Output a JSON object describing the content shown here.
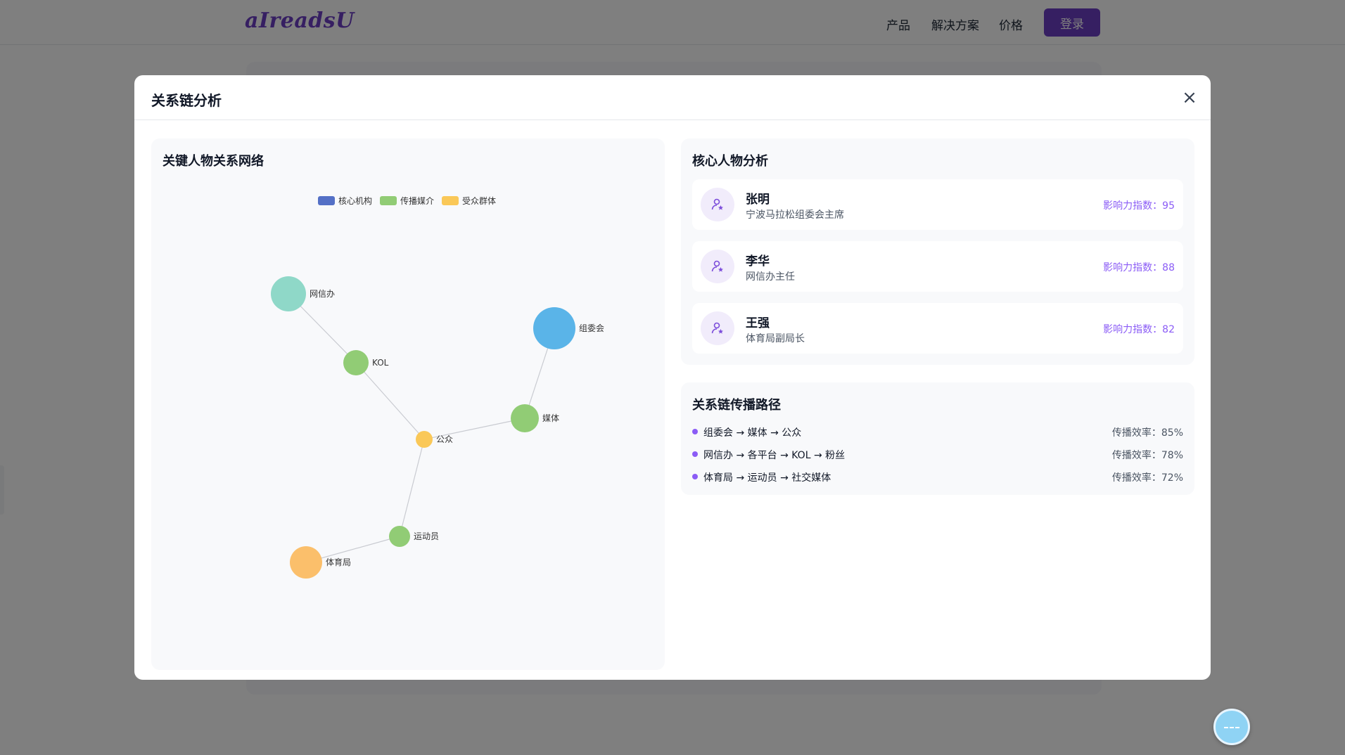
{
  "topnav": {
    "logo": "aIreadsU",
    "links": [
      "产品",
      "解决方案",
      "价格"
    ],
    "login": "登录"
  },
  "modal": {
    "title": "关系链分析",
    "close": "×"
  },
  "network": {
    "title": "关键人物关系网络",
    "legend": [
      {
        "label": "核心机构",
        "color": "#5470c6"
      },
      {
        "label": "传播媒介",
        "color": "#91cc75"
      },
      {
        "label": "受众群体",
        "color": "#fac858"
      }
    ],
    "nodes": [
      {
        "label": "网信办",
        "color": "#8fd8c8"
      },
      {
        "label": "KOL",
        "color": "#91cc75"
      },
      {
        "label": "组委会",
        "color": "#5ab4e8"
      },
      {
        "label": "媒体",
        "color": "#91cc75"
      },
      {
        "label": "公众",
        "color": "#fac858"
      },
      {
        "label": "运动员",
        "color": "#91cc75"
      },
      {
        "label": "体育局",
        "color": "#fbbf6b"
      }
    ],
    "edges": [
      [
        "网信办",
        "KOL"
      ],
      [
        "KOL",
        "公众"
      ],
      [
        "组委会",
        "媒体"
      ],
      [
        "媒体",
        "公众"
      ],
      [
        "公众",
        "运动员"
      ],
      [
        "运动员",
        "体育局"
      ]
    ]
  },
  "people": {
    "title": "核心人物分析",
    "avatar_icon": "user-star-icon",
    "items": [
      {
        "name": "张明",
        "role": "宁波马拉松组委会主席",
        "score": "影响力指数：95"
      },
      {
        "name": "李华",
        "role": "网信办主任",
        "score": "影响力指数：88"
      },
      {
        "name": "王强",
        "role": "体育局副局长",
        "score": "影响力指数：82"
      }
    ]
  },
  "paths": {
    "title": "关系链传播路径",
    "items": [
      {
        "path": "组委会 → 媒体 → 公众",
        "rate": "传播效率：85%"
      },
      {
        "path": "网信办 → 各平台 → KOL → 粉丝",
        "rate": "传播效率：78%"
      },
      {
        "path": "体育局 → 运动员 → 社交媒体",
        "rate": "传播效率：72%"
      }
    ]
  },
  "colors": {
    "accent": "#6d3fc4",
    "score": "#8b5cf6",
    "overlay": "rgba(0,0,0,0.5)"
  },
  "float_button": "chat-icon"
}
